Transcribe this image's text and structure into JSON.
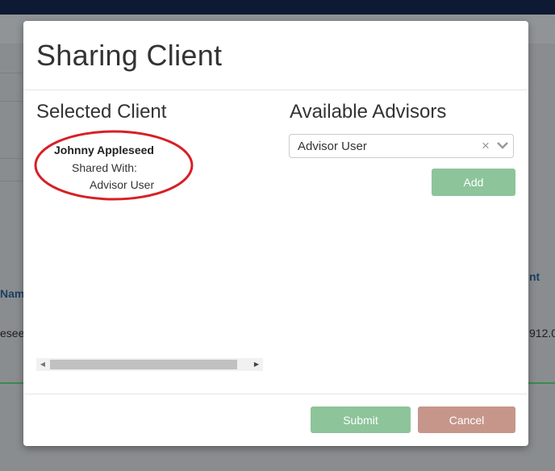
{
  "background": {
    "header_fragments": [
      "Nam",
      "nt"
    ],
    "cell_fragments": [
      "esee",
      "912.0"
    ]
  },
  "modal": {
    "title": "Sharing Client",
    "selected_client": {
      "heading": "Selected Client",
      "client_name": "Johnny Appleseed",
      "shared_with_label": "Shared With:",
      "shared_with_user": "Advisor User"
    },
    "available_advisors": {
      "heading": "Available Advisors",
      "selected_value": "Advisor User",
      "clear_glyph": "×",
      "add_label": "Add"
    },
    "footer": {
      "submit_label": "Submit",
      "cancel_label": "Cancel"
    }
  },
  "colors": {
    "topbar": "#0e1a33",
    "button_green": "#8dc49a",
    "button_cancel": "#c6968b",
    "annotation_red": "#d81f26"
  },
  "icons": [
    "clear-icon",
    "chevron-down-icon",
    "scroll-left-icon",
    "scroll-right-icon"
  ]
}
